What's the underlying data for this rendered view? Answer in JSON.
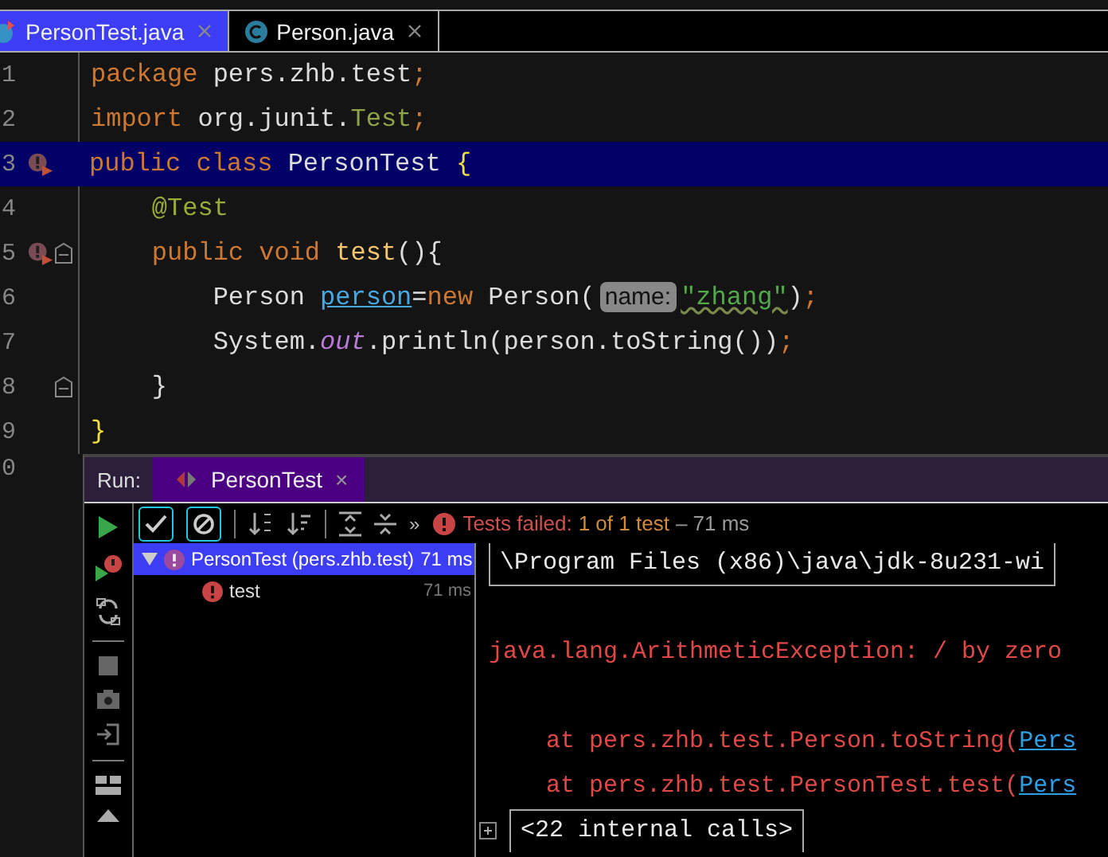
{
  "editor_tabs": [
    {
      "label": "PersonTest.java",
      "selected": true,
      "kind": "test"
    },
    {
      "label": "Person.java",
      "selected": false,
      "kind": "class"
    }
  ],
  "lines": [
    {
      "number": "1",
      "highlighted": false,
      "run_marker": false,
      "fold": false,
      "tokens": [
        {
          "kind": "keyword",
          "text": "package"
        },
        {
          "kind": "plain",
          "text": " pers.zhb.test"
        },
        {
          "kind": "punct",
          "text": ";"
        }
      ]
    },
    {
      "number": "2",
      "highlighted": false,
      "run_marker": false,
      "fold": false,
      "tokens": [
        {
          "kind": "keyword",
          "text": "import"
        },
        {
          "kind": "plain",
          "text": " org.junit."
        },
        {
          "kind": "classref",
          "text": "Test"
        },
        {
          "kind": "punct",
          "text": ";"
        }
      ]
    },
    {
      "number": "3",
      "highlighted": true,
      "run_marker": true,
      "fold": false,
      "tokens": [
        {
          "kind": "keyword",
          "text": "public class"
        },
        {
          "kind": "plain",
          "text": " PersonTest "
        },
        {
          "kind": "brace",
          "text": "{"
        }
      ]
    },
    {
      "number": "4",
      "highlighted": false,
      "run_marker": false,
      "fold": false,
      "tokens": [
        {
          "kind": "annotation",
          "text": "    @Test"
        }
      ]
    },
    {
      "number": "5",
      "highlighted": false,
      "run_marker": true,
      "fold": true,
      "tokens": [
        {
          "kind": "keyword",
          "text": "    public void "
        },
        {
          "kind": "method",
          "text": "test"
        },
        {
          "kind": "plain",
          "text": "(){"
        }
      ]
    },
    {
      "number": "6",
      "highlighted": false,
      "run_marker": false,
      "fold": false,
      "tokens": [
        {
          "kind": "plain",
          "text": "        Person "
        },
        {
          "kind": "variable",
          "text": "person"
        },
        {
          "kind": "plain",
          "text": "="
        },
        {
          "kind": "keyword",
          "text": "new"
        },
        {
          "kind": "plain",
          "text": " Person("
        },
        {
          "kind": "hint",
          "text": "name:"
        },
        {
          "kind": "string",
          "text": "\"zhang\""
        },
        {
          "kind": "plain",
          "text": ")"
        },
        {
          "kind": "punct",
          "text": ";"
        }
      ]
    },
    {
      "number": "7",
      "highlighted": false,
      "run_marker": false,
      "fold": false,
      "tokens": [
        {
          "kind": "plain",
          "text": "        System."
        },
        {
          "kind": "static",
          "text": "out"
        },
        {
          "kind": "plain",
          "text": ".println(person.toString())"
        },
        {
          "kind": "punct",
          "text": ";"
        }
      ]
    },
    {
      "number": "8",
      "highlighted": false,
      "run_marker": false,
      "fold": true,
      "tokens": [
        {
          "kind": "plain",
          "text": "    }"
        }
      ]
    },
    {
      "number": "9",
      "highlighted": false,
      "run_marker": false,
      "fold": false,
      "tokens": [
        {
          "kind": "brace",
          "text": "}"
        }
      ]
    }
  ],
  "cut_line_number": "0",
  "run_panel": {
    "label": "Run:",
    "tab": {
      "label": "PersonTest",
      "close": "×"
    },
    "toolbar": {
      "show_passed": {
        "selected": true
      },
      "show_ignored": {
        "selected": true
      },
      "more": "»",
      "status": "Tests failed:",
      "count": "1 of 1 test",
      "time": "– 71 ms"
    },
    "tree": [
      {
        "label": "PersonTest (pers.zhb.test)",
        "time": "71 ms",
        "selected": true,
        "expanded": true,
        "children": [
          {
            "label": "test",
            "time": "71 ms",
            "selected": false
          }
        ]
      }
    ],
    "console": [
      {
        "kind": "command",
        "text": "\\Program Files (x86)\\java\\jdk-8u231-wi"
      },
      {
        "kind": "error",
        "text": "java.lang.ArithmeticException: / by zero"
      },
      {
        "kind": "trace",
        "text": "    at pers.zhb.test.Person.toString(",
        "link": "Pers"
      },
      {
        "kind": "trace",
        "text": "    at pers.zhb.test.PersonTest.test(",
        "link": "Pers"
      },
      {
        "kind": "folded",
        "text": "<22 internal calls>"
      }
    ]
  }
}
